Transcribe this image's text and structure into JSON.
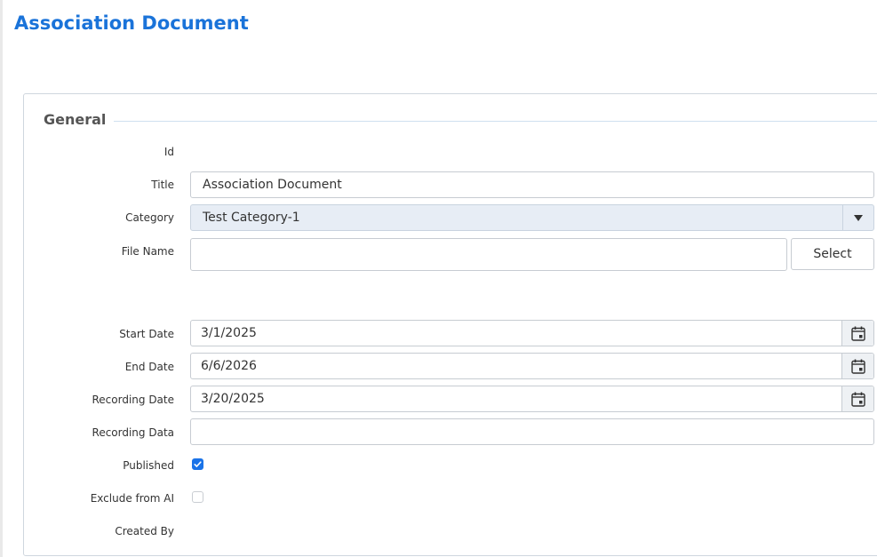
{
  "page": {
    "title": "Association Document"
  },
  "section": {
    "title": "General"
  },
  "fields": {
    "id": {
      "label": "Id",
      "value": ""
    },
    "title": {
      "label": "Title",
      "value": "Association Document"
    },
    "category": {
      "label": "Category",
      "value": "Test Category-1"
    },
    "file_name": {
      "label": "File Name",
      "value": "",
      "button": "Select"
    },
    "start_date": {
      "label": "Start Date",
      "value": "3/1/2025"
    },
    "end_date": {
      "label": "End Date",
      "value": "6/6/2026"
    },
    "recording_date": {
      "label": "Recording Date",
      "value": "3/20/2025"
    },
    "recording_data": {
      "label": "Recording Data",
      "value": ""
    },
    "published": {
      "label": "Published",
      "checked": true
    },
    "exclude_from_ai": {
      "label": "Exclude from AI",
      "checked": false
    },
    "created_by": {
      "label": "Created By",
      "value": ""
    }
  },
  "icons": {
    "calendar": "calendar-icon",
    "dropdown": "chevron-down-icon",
    "check": "checkmark-icon"
  },
  "colors": {
    "title": "#1a73d9",
    "accent": "#1a73e8",
    "select_bg": "#e7edf5"
  }
}
